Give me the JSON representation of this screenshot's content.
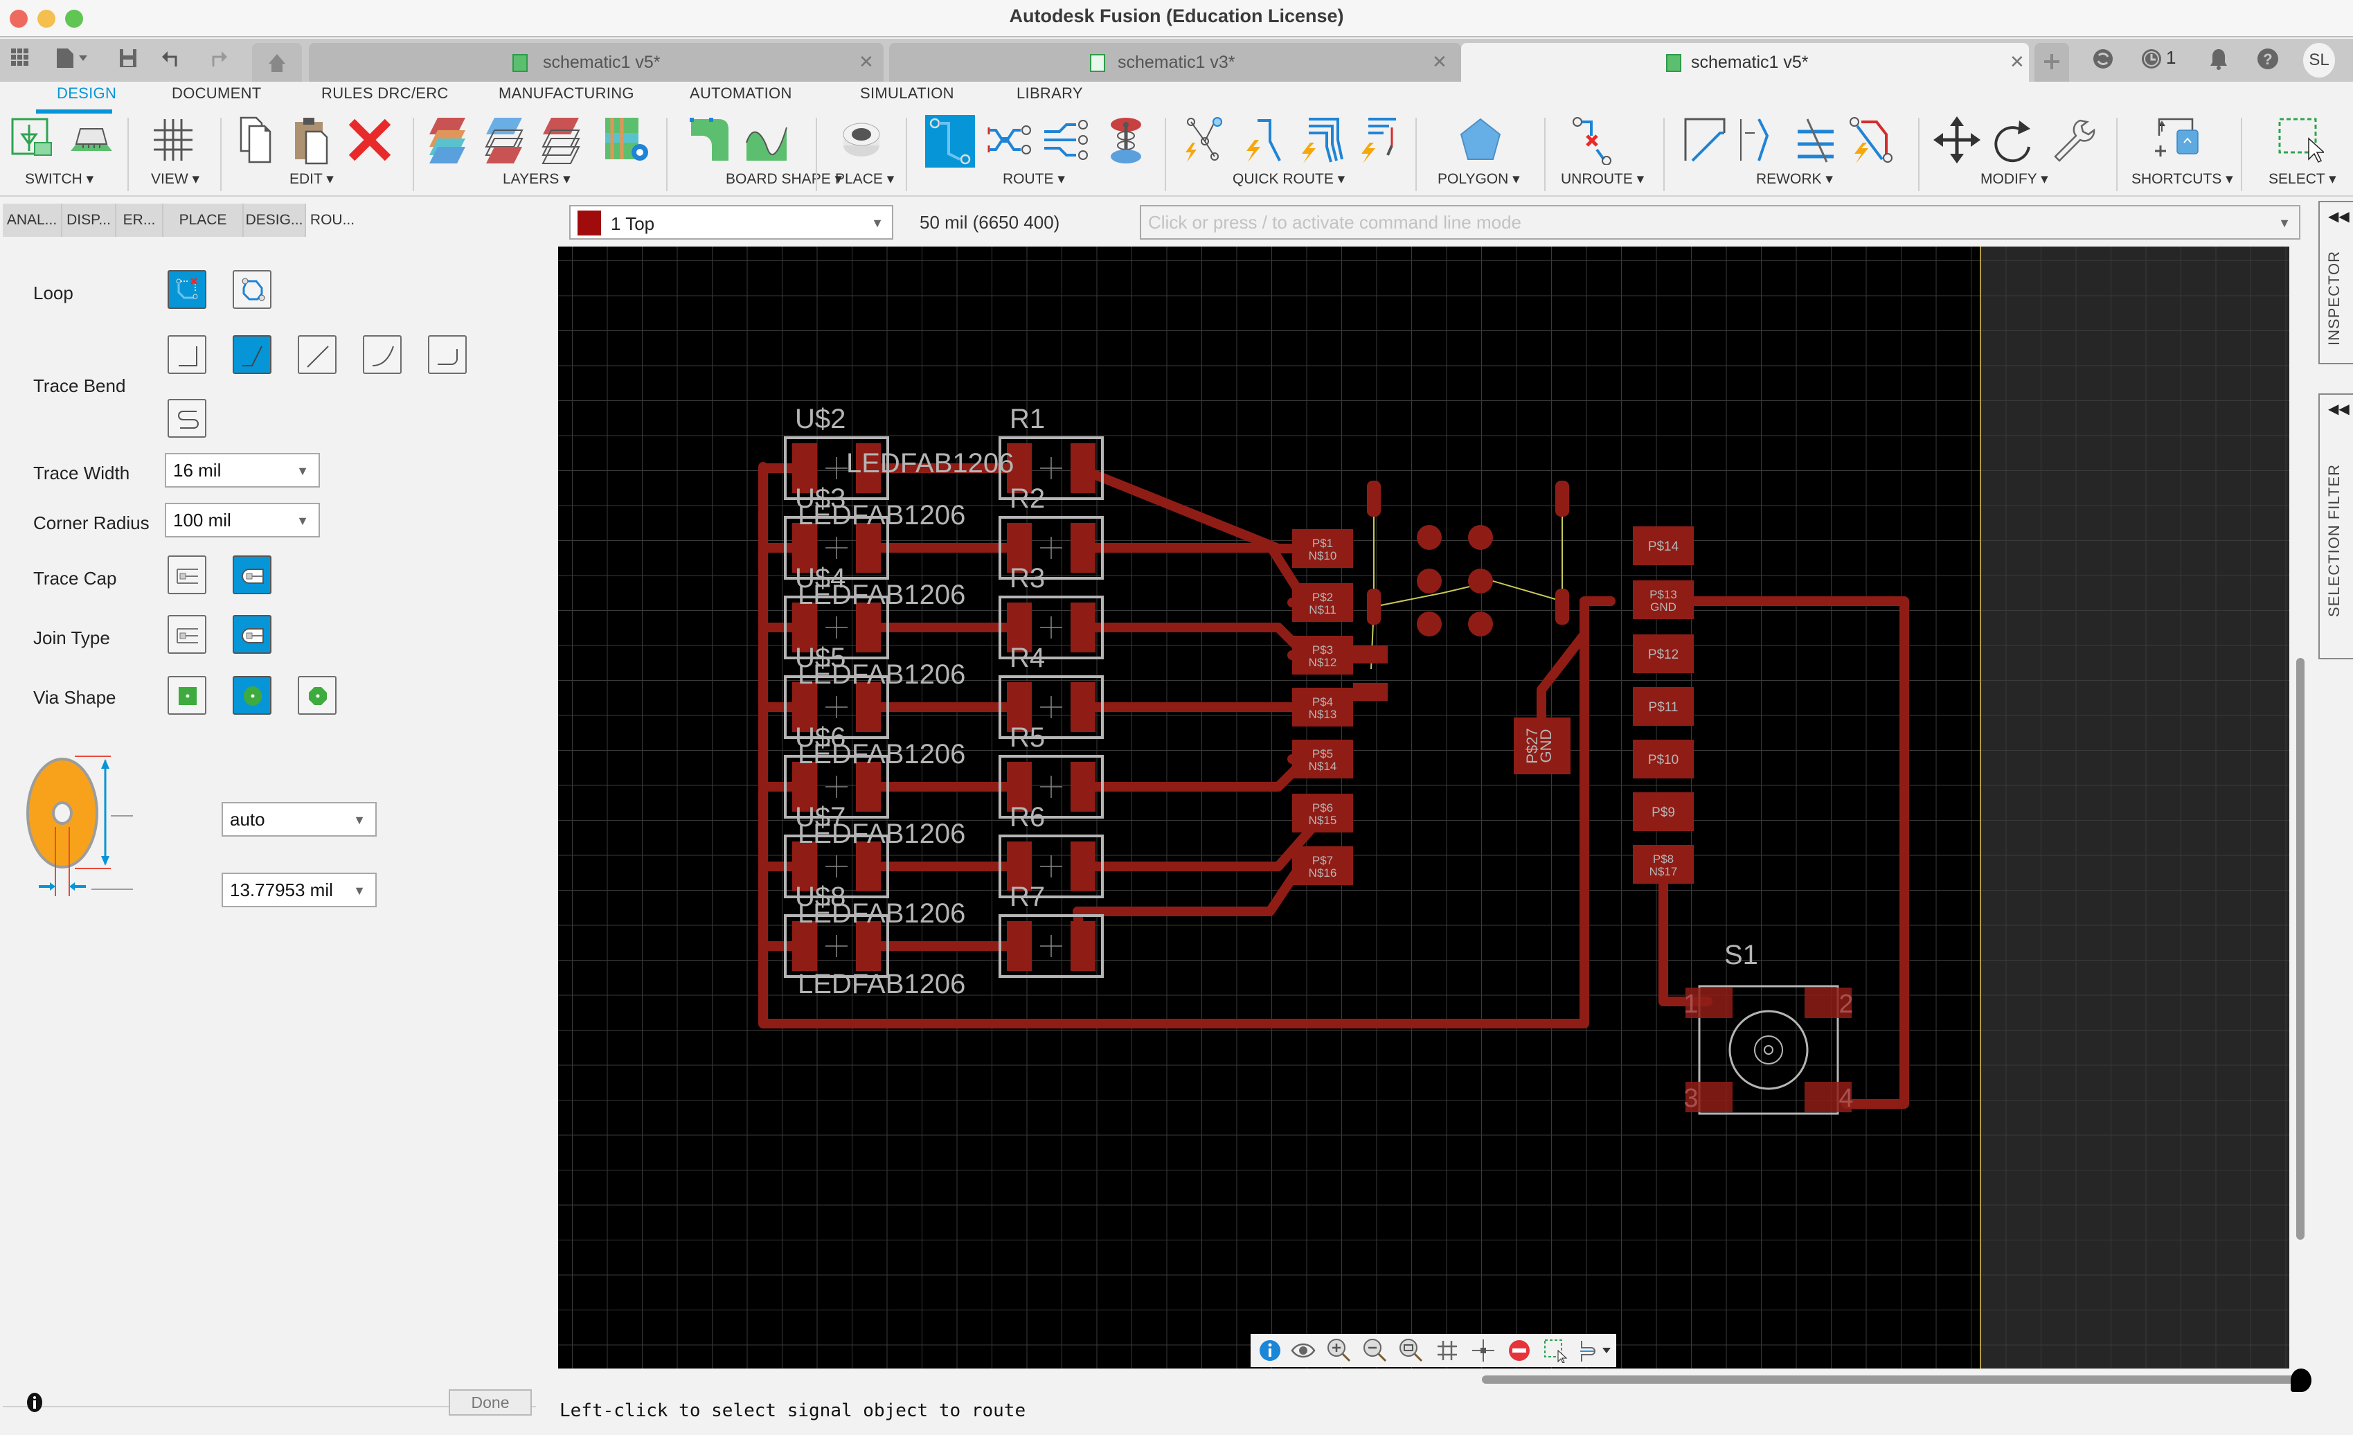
{
  "window": {
    "title": "Autodesk Fusion (Education License)"
  },
  "doc_tabs": [
    {
      "label": "schematic1 v5*",
      "active": false
    },
    {
      "label": "schematic1 v3*",
      "active": false
    },
    {
      "label": "schematic1 v5*",
      "active": true
    }
  ],
  "header_right": {
    "jobs_count": "1",
    "user_initials": "SL"
  },
  "ribbon_tabs": [
    "DESIGN",
    "DOCUMENT",
    "RULES DRC/ERC",
    "MANUFACTURING",
    "AUTOMATION",
    "SIMULATION",
    "LIBRARY"
  ],
  "ribbon_active_tab": "DESIGN",
  "ribbon_groups": [
    {
      "label": "SWITCH ▾",
      "icons": [
        "switch-to-schematic-icon",
        "switch-to-3d-pcb-icon"
      ]
    },
    {
      "label": "VIEW ▾",
      "icons": [
        "grid-icon"
      ]
    },
    {
      "label": "EDIT ▾",
      "icons": [
        "copy-icon",
        "paste-icon",
        "delete-icon"
      ]
    },
    {
      "label": "LAYERS ▾",
      "icons": [
        "layer-settings-icon",
        "layer-top-icon",
        "layer-bottom-icon",
        "layer-stackup-icon"
      ]
    },
    {
      "label": "BOARD SHAPE ▾",
      "icons": [
        "board-outline-icon",
        "board-curve-icon"
      ]
    },
    {
      "label": "PLACE ▾",
      "icons": [
        "via-icon"
      ]
    },
    {
      "label": "ROUTE ▾",
      "icons": [
        "route-manual-icon",
        "route-differential-icon",
        "route-multiple-icon",
        "via-stack-icon"
      ]
    },
    {
      "label": "QUICK ROUTE ▾",
      "icons": [
        "quick-route-airwire-icon",
        "quick-route-signal-icon",
        "quick-route-multiple-icon",
        "quick-route-fanout-icon"
      ]
    },
    {
      "label": "POLYGON ▾",
      "icons": [
        "polygon-icon"
      ]
    },
    {
      "label": "UNROUTE ▾",
      "icons": [
        "unroute-icon"
      ]
    },
    {
      "label": "REWORK ▾",
      "icons": [
        "rework-slide-icon",
        "rework-bend-icon",
        "rework-spread-icon",
        "rework-reroute-icon"
      ]
    },
    {
      "label": "MODIFY ▾",
      "icons": [
        "move-icon",
        "rotate-icon",
        "wrench-icon"
      ]
    },
    {
      "label": "SHORTCUTS ▾",
      "icons": [
        "shortcuts-icon"
      ]
    },
    {
      "label": "SELECT ▾",
      "icons": [
        "window-select-icon"
      ]
    }
  ],
  "panel_tabs": [
    "ANAL...",
    "DISP...",
    "ER...",
    "PLACE CO...",
    "DESIG...",
    "ROU..."
  ],
  "panel_active_tab": "ROU...",
  "layer_select": {
    "value": "1 Top",
    "color": "#a00c0c"
  },
  "grid_readout": "50 mil (6650 400)",
  "command_line": {
    "placeholder": "Click or press / to activate command line mode",
    "value": ""
  },
  "route_options": {
    "loop_label": "Loop",
    "trace_bend_label": "Trace Bend",
    "trace_width_label": "Trace Width",
    "trace_width_value": "16 mil",
    "corner_radius_label": "Corner Radius",
    "corner_radius_value": "100 mil",
    "trace_cap_label": "Trace Cap",
    "join_type_label": "Join Type",
    "via_shape_label": "Via Shape",
    "via_diameter_value": "auto",
    "via_drill_value": "13.77953 mil",
    "done_label": "Done"
  },
  "side_panels": {
    "inspector": "INSPECTOR",
    "selection_filter": "SELECTION FILTER"
  },
  "status_text": "Left-click to select signal object to route",
  "pcb": {
    "parts_left": [
      "U$2",
      "U$3",
      "U$4",
      "U$5",
      "U$6",
      "U$7",
      "U$8"
    ],
    "parts_right": [
      "R1",
      "R2",
      "R3",
      "R4",
      "R5",
      "R6",
      "R7"
    ],
    "led_value": "LEDFAB1206",
    "header_left": [
      {
        "pad": "P$1",
        "net": "N$10"
      },
      {
        "pad": "P$2",
        "net": "N$11"
      },
      {
        "pad": "P$3",
        "net": "N$12"
      },
      {
        "pad": "P$4",
        "net": "N$13"
      },
      {
        "pad": "P$5",
        "net": "N$14"
      },
      {
        "pad": "P$6",
        "net": "N$15"
      },
      {
        "pad": "P$7",
        "net": "N$16"
      }
    ],
    "header_right": [
      {
        "pad": "P$14",
        "net": ""
      },
      {
        "pad": "P$13",
        "net": "GND"
      },
      {
        "pad": "P$12",
        "net": ""
      },
      {
        "pad": "P$11",
        "net": ""
      },
      {
        "pad": "P$10",
        "net": ""
      },
      {
        "pad": "P$9",
        "net": ""
      },
      {
        "pad": "P$8",
        "net": "N$17"
      }
    ],
    "gnd_pad": {
      "pad": "P$27",
      "net": "GND"
    },
    "switch_name": "S1",
    "switch_pins": [
      "1",
      "2",
      "3",
      "4"
    ],
    "copper_color": "#8f1d16"
  }
}
